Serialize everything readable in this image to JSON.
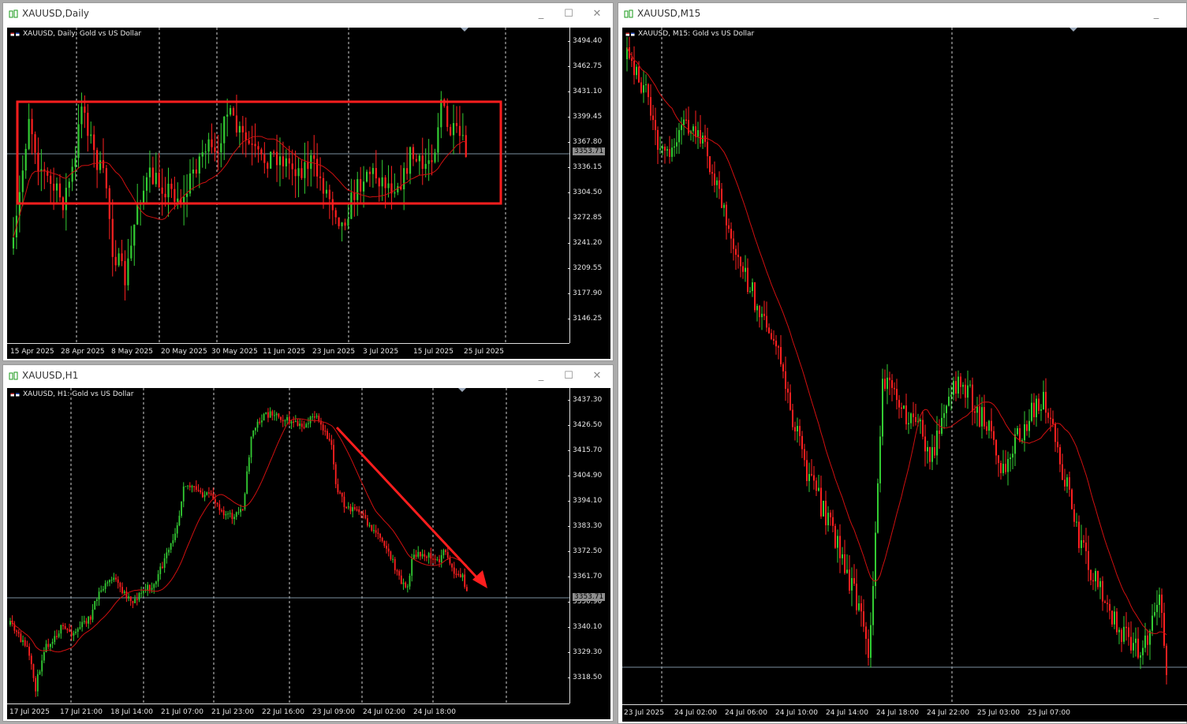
{
  "colors": {
    "bull": "#33cc33",
    "bear": "#ff2020",
    "ma": "#d01010",
    "annotation": "#ff1e1e",
    "grid": "#d0d0d0",
    "current_line": "#7c8fa0"
  },
  "icons": {
    "title": "candlestick-icon",
    "header": "chart-window-icons",
    "minimize": "minimize-icon",
    "maximize": "maximize-icon",
    "close": "close-icon"
  },
  "window_controls": {
    "minimize": "_",
    "maximize": "☐",
    "close": "✕"
  },
  "windows": [
    {
      "id": "daily",
      "title": "XAUUSD,Daily",
      "header": "XAUUSD, Daily:  Gold vs US Dollar",
      "current_price": "3353.71",
      "has_controls": true,
      "price_labels": [
        "3494.40",
        "3462.75",
        "3431.10",
        "3399.45",
        "3367.80",
        "3336.15",
        "3304.50",
        "3272.85",
        "3241.20",
        "3209.55",
        "3177.90",
        "3146.25"
      ],
      "time_labels": [
        "15 Apr 2025",
        "28 Apr 2025",
        "8 May 2025",
        "20 May 2025",
        "30 May 2025",
        "11 Jun 2025",
        "23 Jun 2025",
        "3 Jul 2025",
        "15 Jul 2025",
        "25 Jul 2025"
      ]
    },
    {
      "id": "h1",
      "title": "XAUUSD,H1",
      "header": "XAUUSD, H1:  Gold vs US Dollar",
      "current_price": "3353.71",
      "has_controls": true,
      "price_labels": [
        "3437.30",
        "3426.50",
        "3415.70",
        "3404.90",
        "3394.10",
        "3383.30",
        "3372.50",
        "3361.70",
        "3350.90",
        "3340.10",
        "3329.30",
        "3318.50"
      ],
      "time_labels": [
        "17 Jul 2025",
        "17 Jul 21:00",
        "18 Jul 14:00",
        "21 Jul 07:00",
        "21 Jul 23:00",
        "22 Jul 16:00",
        "23 Jul 09:00",
        "24 Jul 02:00",
        "24 Jul 18:00"
      ]
    },
    {
      "id": "m15",
      "title": "XAUUSD,M15",
      "header": "XAUUSD, M15:  Gold vs US Dollar",
      "has_controls": false,
      "price_labels": [],
      "time_labels": [
        "23 Jul 2025",
        "24 Jul 02:00",
        "24 Jul 06:00",
        "24 Jul 10:00",
        "24 Jul 14:00",
        "24 Jul 18:00",
        "24 Jul 22:00",
        "25 Jul 03:00",
        "25 Jul 07:00"
      ]
    }
  ]
}
